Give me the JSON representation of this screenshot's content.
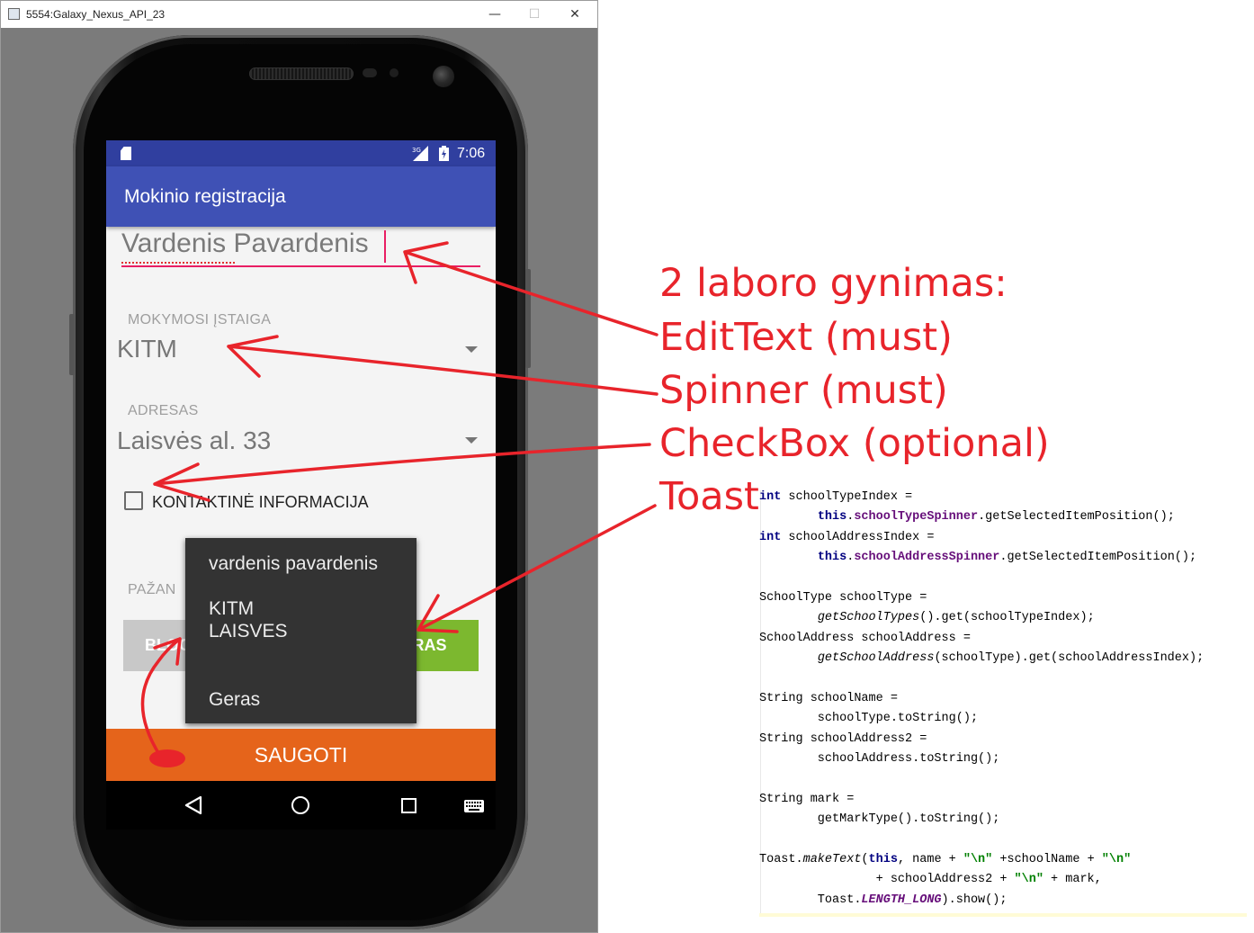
{
  "window": {
    "title": "5554:Galaxy_Nexus_API_23",
    "minimize": "—",
    "maximize": "☐",
    "close": "✕"
  },
  "statusbar": {
    "network": "3G",
    "time": "7:06"
  },
  "app": {
    "title": "Mokinio registracija",
    "name_value": "Vardenis Pavardenis",
    "school_label": "MOKYMOSI ĮSTAIGA",
    "school_value": "KITM",
    "address_label": "ADRESAS",
    "address_value": "Laisvės al. 33",
    "checkbox_label": "KONTAKTINĖ INFORMACIJA",
    "marks_label_visible": "PAŽAN",
    "btn_bad_visible": "BLOG",
    "btn_good_visible": "RAS",
    "save_button": "SAUGOTI"
  },
  "toast": {
    "line1": "vardenis pavardenis",
    "line2": "KITM",
    "line3": "LAISVES",
    "line4": "Geras"
  },
  "annotations": {
    "heading": "2 laboro gynimas:",
    "item1": "EditText (must)",
    "item2": "Spinner (must)",
    "item3": "CheckBox (optional)",
    "item4": "Toast"
  },
  "colors": {
    "statusbar": "#303f9f",
    "appbar": "#3f51b5",
    "accent": "#e91e63",
    "save_button": "#e5641b",
    "good_button": "#7cb82f",
    "annotation": "#e8242b"
  },
  "code": {
    "l1a": "int",
    "l1b": " schoolTypeIndex =",
    "l2a": "        ",
    "l2b": "this",
    "l2c": ".",
    "l2d": "schoolTypeSpinner",
    "l2e": ".getSelectedItemPosition();",
    "l3a": "int",
    "l3b": " schoolAddressIndex =",
    "l4a": "        ",
    "l4b": "this",
    "l4c": ".",
    "l4d": "schoolAddressSpinner",
    "l4e": ".getSelectedItemPosition();",
    "l5": "SchoolType schoolType =",
    "l6a": "        ",
    "l6b": "getSchoolTypes",
    "l6c": "().get(schoolTypeIndex);",
    "l7": "SchoolAddress schoolAddress =",
    "l8a": "        ",
    "l8b": "getSchoolAddress",
    "l8c": "(schoolType).get(schoolAddressIndex);",
    "l9": "String schoolName =",
    "l10": "        schoolType.toString();",
    "l11": "String schoolAddress2 =",
    "l12": "        schoolAddress.toString();",
    "l13": "String mark =",
    "l14": "        getMarkType().toString();",
    "l15a": "Toast.",
    "l15b": "makeText",
    "l15c": "(",
    "l15d": "this",
    "l15e": ", name + ",
    "l15f": "\"\\n\"",
    "l15g": " +schoolName + ",
    "l15h": "\"\\n\"",
    "l16a": "                + schoolAddress2 + ",
    "l16b": "\"\\n\"",
    "l16c": " + mark,",
    "l17a": "        Toast.",
    "l17b": "LENGTH_LONG",
    "l17c": ").show();"
  }
}
